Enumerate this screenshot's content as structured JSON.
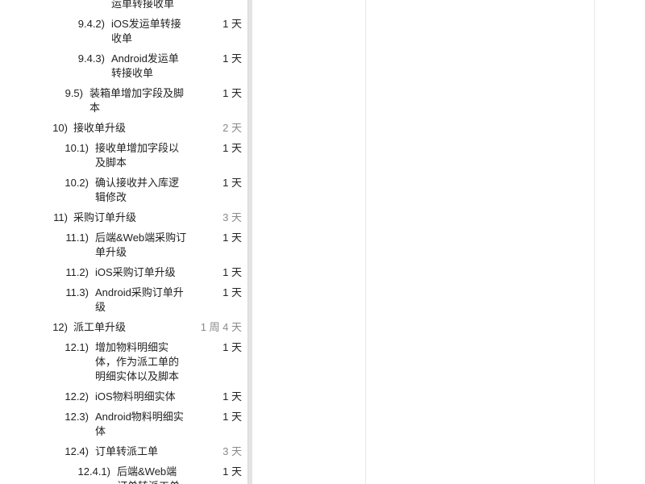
{
  "tasks": [
    {
      "number": "",
      "title": "运单转接收单",
      "duration": "",
      "level": 3,
      "group": false
    },
    {
      "number": "9.4.2)",
      "title": "iOS发运单转接收单",
      "duration": "1 天",
      "level": 3,
      "group": false
    },
    {
      "number": "9.4.3)",
      "title": "Android发运单转接收单",
      "duration": "1 天",
      "level": 3,
      "group": false
    },
    {
      "number": "9.5)",
      "title": "装箱单增加字段及脚本",
      "duration": "1 天",
      "level": 2,
      "group": false
    },
    {
      "number": "10)",
      "title": "接收单升级",
      "duration": "2 天",
      "level": 1,
      "group": true
    },
    {
      "number": "10.1)",
      "title": "接收单增加字段以及脚本",
      "duration": "1 天",
      "level": 2,
      "group": false
    },
    {
      "number": "10.2)",
      "title": "确认接收并入库逻辑修改",
      "duration": "1 天",
      "level": 2,
      "group": false
    },
    {
      "number": "11)",
      "title": "采购订单升级",
      "duration": "3 天",
      "level": 1,
      "group": true
    },
    {
      "number": "11.1)",
      "title": "后端&Web端采购订单升级",
      "duration": "1 天",
      "level": 2,
      "group": false
    },
    {
      "number": "11.2)",
      "title": "iOS采购订单升级",
      "duration": "1 天",
      "level": 2,
      "group": false
    },
    {
      "number": "11.3)",
      "title": "Android采购订单升级",
      "duration": "1 天",
      "level": 2,
      "group": false
    },
    {
      "number": "12)",
      "title": "派工单升级",
      "duration": "1 周 4 天",
      "level": 1,
      "group": true
    },
    {
      "number": "12.1)",
      "title": "增加物料明细实体，作为派工单的明细实体以及脚本",
      "duration": "1 天",
      "level": 2,
      "group": false
    },
    {
      "number": "12.2)",
      "title": "iOS物料明细实体",
      "duration": "1 天",
      "level": 2,
      "group": false
    },
    {
      "number": "12.3)",
      "title": "Android物料明细实体",
      "duration": "1 天",
      "level": 2,
      "group": false
    },
    {
      "number": "12.4)",
      "title": "订单转派工单",
      "duration": "3 天",
      "level": 2,
      "group": true
    },
    {
      "number": "12.4.1)",
      "title": "后端&Web端订单转派工单",
      "duration": "1 天",
      "level": 3,
      "group": false
    }
  ]
}
